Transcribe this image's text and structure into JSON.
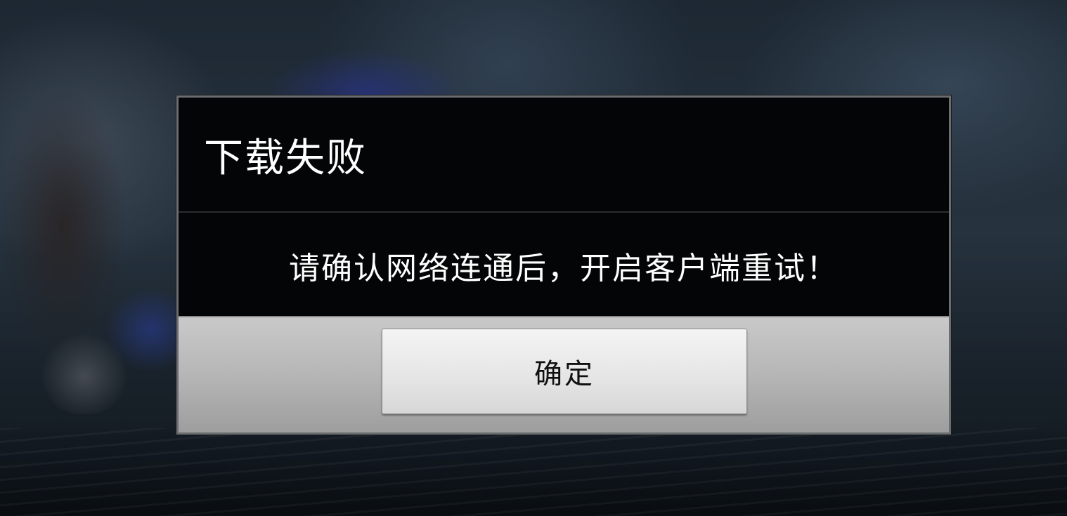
{
  "dialog": {
    "title": "下载失败",
    "message": "请确认网络连通后，开启客户端重试！",
    "confirm_label": "确定"
  }
}
